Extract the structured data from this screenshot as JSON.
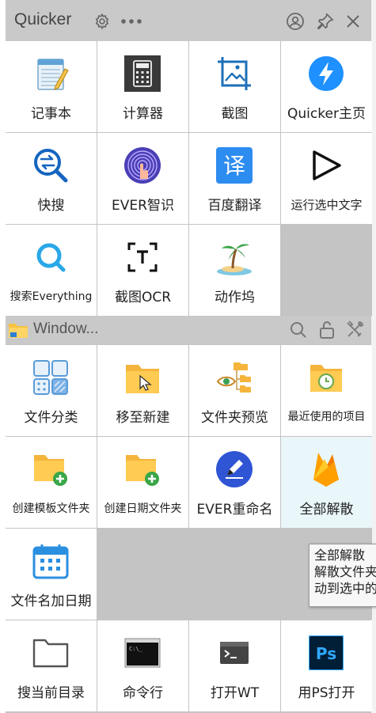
{
  "app": {
    "title": "Quicker"
  },
  "section1": {
    "items": [
      {
        "label": "记事本",
        "icon": "notepad-icon"
      },
      {
        "label": "计算器",
        "icon": "calculator-icon"
      },
      {
        "label": "截图",
        "icon": "screenshot-icon"
      },
      {
        "label": "Quicker主页",
        "icon": "lightning-icon"
      },
      {
        "label": "快搜",
        "icon": "quick-search-icon"
      },
      {
        "label": "EVER智识",
        "icon": "fingerprint-icon"
      },
      {
        "label": "百度翻译",
        "icon": "translate-icon"
      },
      {
        "label": "运行选中文字",
        "icon": "play-icon"
      },
      {
        "label": "搜索Everything",
        "icon": "everything-search-icon"
      },
      {
        "label": "截图OCR",
        "icon": "ocr-icon"
      },
      {
        "label": "动作坞",
        "icon": "palm-island-icon"
      }
    ]
  },
  "section2": {
    "title": "Window...",
    "items": [
      {
        "label": "文件分类",
        "icon": "categorize-icon"
      },
      {
        "label": "移至新建",
        "icon": "move-to-new-folder-icon"
      },
      {
        "label": "文件夹预览",
        "icon": "folder-preview-icon"
      },
      {
        "label": "最近使用的项目",
        "icon": "recent-items-icon"
      },
      {
        "label": "创建模板文件夹",
        "icon": "folder-add-icon"
      },
      {
        "label": "创建日期文件夹",
        "icon": "folder-add-icon"
      },
      {
        "label": "EVER重命名",
        "icon": "rename-pen-icon"
      },
      {
        "label": "全部解散",
        "icon": "firebase-flame-icon"
      },
      {
        "label": "文件名加日期",
        "icon": "calendar-icon"
      }
    ]
  },
  "section3": {
    "items": [
      {
        "label": "搜当前目录",
        "icon": "folder-outline-icon"
      },
      {
        "label": "命令行",
        "icon": "cmd-icon"
      },
      {
        "label": "打开WT",
        "icon": "terminal-icon"
      },
      {
        "label": "用PS打开",
        "icon": "photoshop-icon"
      }
    ]
  },
  "tooltip": {
    "lines": [
      "全部解散",
      "解散文件夹",
      "动到选中的"
    ]
  },
  "colors": {
    "accent": "#1e90ff",
    "hover": "#e9f7fa",
    "panel": "#c4c4c4"
  }
}
